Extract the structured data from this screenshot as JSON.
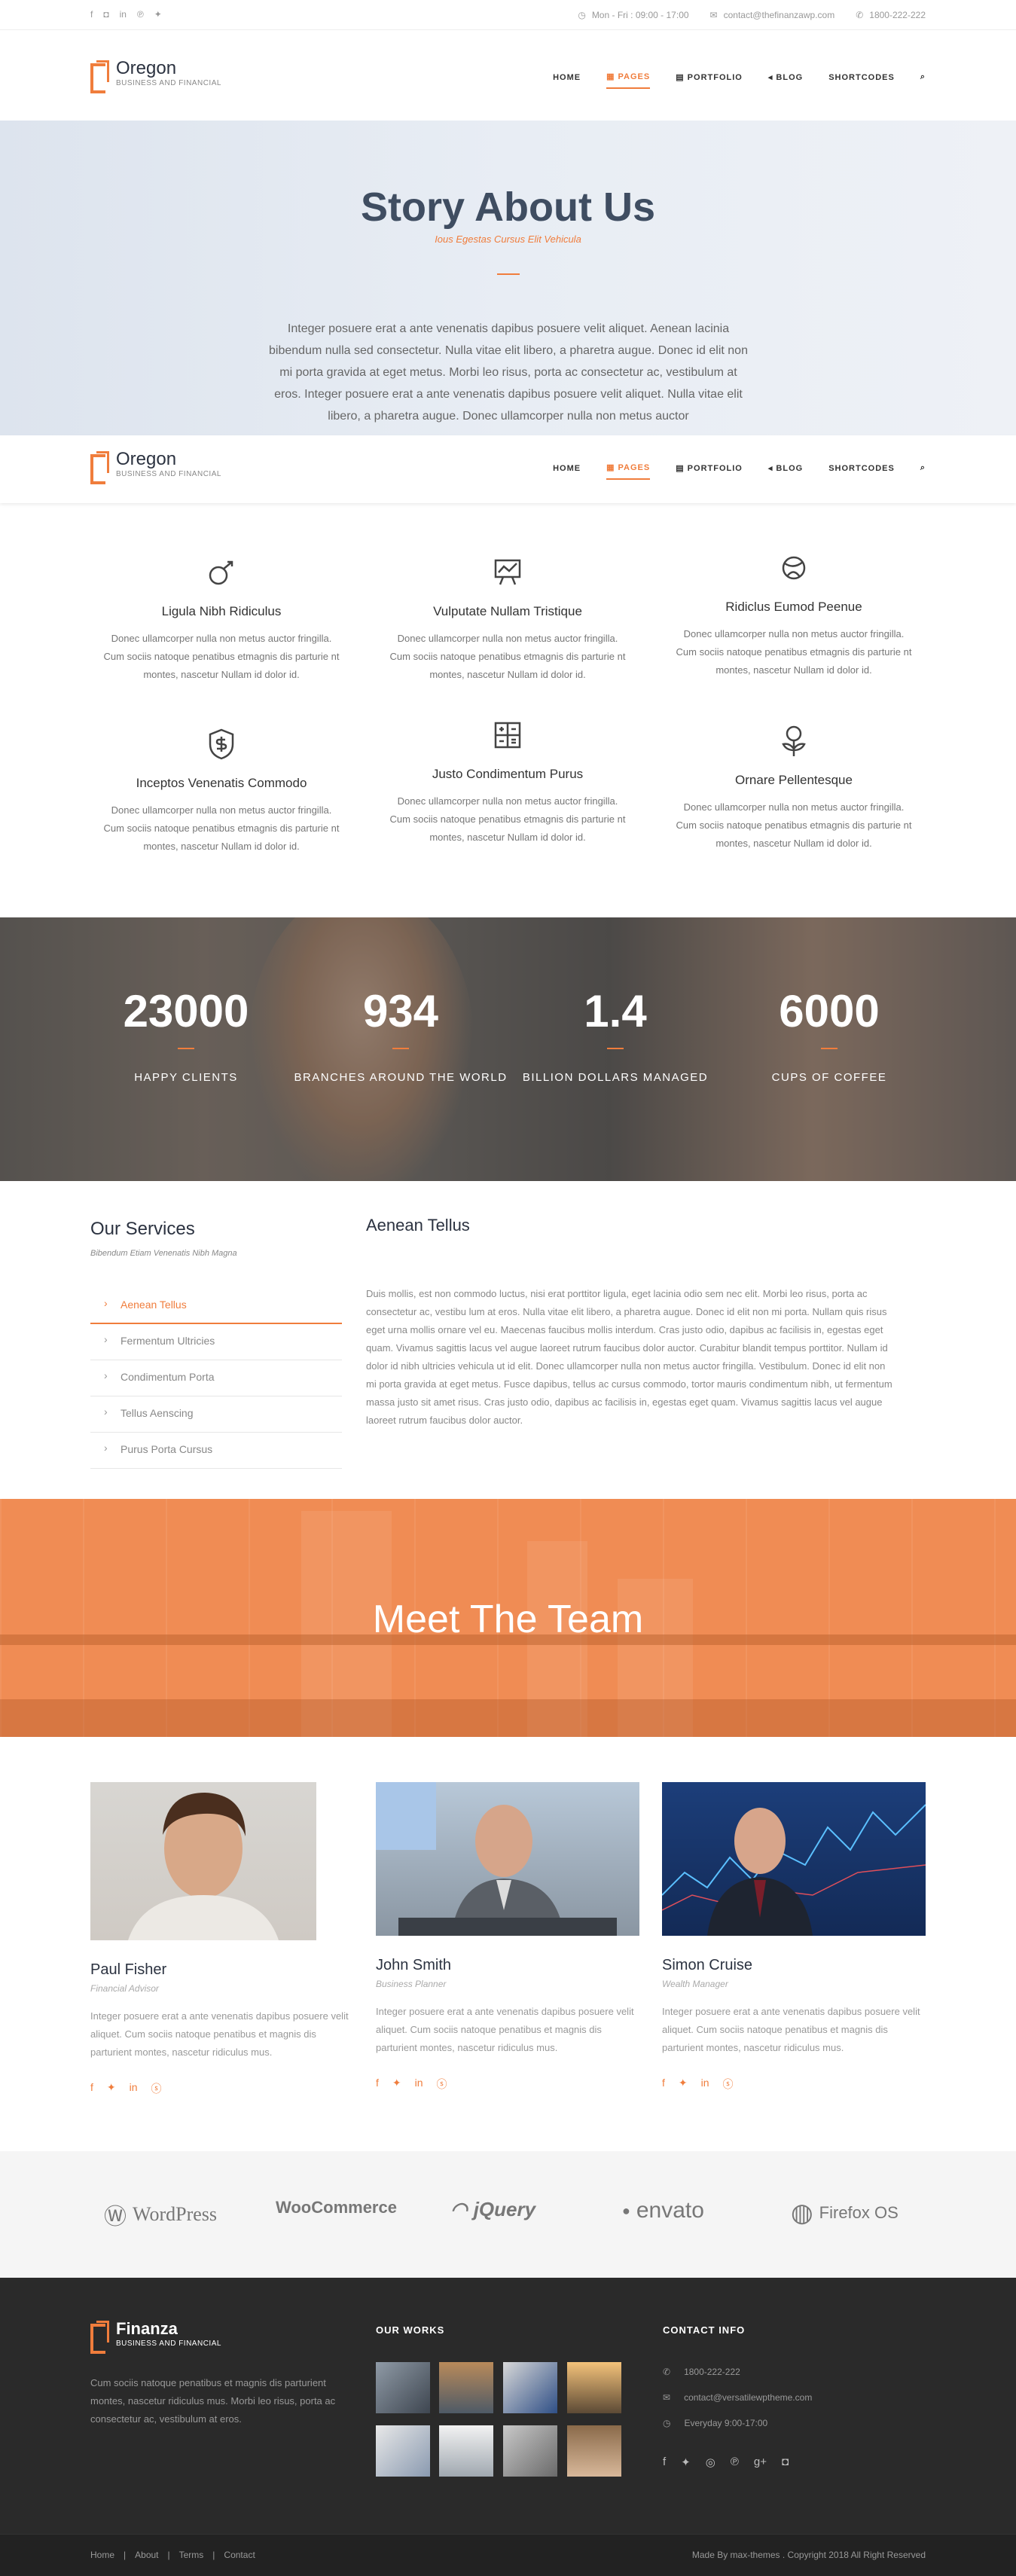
{
  "topbar": {
    "social_icons": [
      "facebook-icon",
      "instagram-icon",
      "linkedin-icon",
      "pinterest-icon",
      "twitter-icon"
    ],
    "hours": "Mon - Fri : 09:00 - 17:00",
    "email": "contact@thefinanzawp.com",
    "phone": "1800-222-222"
  },
  "header": {
    "logo_name": "Oregon",
    "logo_tag": "Business and Financial",
    "nav": [
      "Home",
      "Pages",
      "Portfolio",
      "Blog",
      "Shortcodes"
    ]
  },
  "hero": {
    "title": "Story About Us",
    "subtitle": "Ious Egestas Cursus Elit Vehicula",
    "text": "Integer posuere erat a ante venenatis dapibus posuere velit aliquet. Aenean lacinia bibendum nulla sed consectetur. Nulla vitae elit libero, a pharetra augue. Donec id elit non mi porta gravida at eget metus. Morbi leo risus, porta ac consectetur ac, vestibulum at eros. Integer posuere erat a ante venenatis dapibus posuere velit aliquet. Nulla vitae elit libero, a pharetra augue. Donec ullamcorper nulla non metus auctor"
  },
  "features": [
    {
      "icon": "money-arrow-icon",
      "title": "Ligula Nibh Ridiculus",
      "text": "Donec ullamcorper nulla non metus auctor fringilla. Cum sociis natoque penatibus etmagnis dis parturie nt montes, nascetur Nullam id dolor id."
    },
    {
      "icon": "presentation-chart-icon",
      "title": "Vulputate Nullam Tristique",
      "text": "Donec ullamcorper nulla non metus auctor fringilla. Cum sociis natoque penatibus etmagnis dis parturie nt montes, nascetur Nullam id dolor id."
    },
    {
      "icon": "globe-icon",
      "title": "Ridiclus Eumod Peenue",
      "text": "Donec ullamcorper nulla non metus auctor fringilla. Cum sociis natoque penatibus etmagnis dis parturie nt montes, nascetur Nullam id dolor id."
    },
    {
      "icon": "shield-money-icon",
      "title": "Inceptos Venenatis Commodo",
      "text": "Donec ullamcorper nulla non metus auctor fringilla. Cum sociis natoque penatibus etmagnis dis parturie nt montes, nascetur Nullam id dolor id."
    },
    {
      "icon": "calculator-icon",
      "title": "Justo Condimentum Purus",
      "text": "Donec ullamcorper nulla non metus auctor fringilla. Cum sociis natoque penatibus etmagnis dis parturie nt montes, nascetur Nullam id dolor id."
    },
    {
      "icon": "plant-money-icon",
      "title": "Ornare Pellentesque",
      "text": "Donec ullamcorper nulla non metus auctor fringilla. Cum sociis natoque penatibus etmagnis dis parturie nt montes, nascetur Nullam id dolor id."
    }
  ],
  "counters": [
    {
      "num": "23000",
      "label": "Happy Clients"
    },
    {
      "num": "934",
      "label": "Branches Around The World"
    },
    {
      "num": "1.4",
      "label": "Billion Dollars Managed"
    },
    {
      "num": "6000",
      "label": "Cups Of Coffee"
    }
  ],
  "services": {
    "title": "Our Services",
    "subtitle": "Bibendum Etiam Venenatis Nibh Magna",
    "items": [
      "Aenean Tellus",
      "Fermentum Ultricies",
      "Condimentum Porta",
      "Tellus Aenscing",
      "Purus Porta Cursus"
    ],
    "detail_title": "Aenean Tellus",
    "detail_text": "Duis mollis, est non commodo luctus, nisi erat porttitor ligula, eget lacinia odio sem nec elit. Morbi leo risus, porta ac consectetur ac, vestibu lum at eros. Nulla vitae elit libero, a pharetra augue. Donec id elit non mi porta. Nullam quis risus eget urna mollis ornare vel eu. Maecenas faucibus mollis interdum. Cras justo odio, dapibus ac facilisis in, egestas eget quam. Vivamus sagittis lacus vel augue laoreet rutrum faucibus dolor auctor. Curabitur blandit tempus porttitor. Nullam id dolor id nibh ultricies vehicula ut id elit. Donec ullamcorper nulla non metus auctor fringilla. Vestibulum. Donec id elit non mi porta gravida at eget metus. Fusce dapibus, tellus ac cursus commodo, tortor mauris condimentum nibh, ut fermentum massa justo sit amet risus. Cras justo odio, dapibus ac facilisis in, egestas eget quam. Vivamus sagittis lacus vel augue laoreet rutrum faucibus dolor auctor."
  },
  "team": {
    "banner_title": "Meet The Team",
    "members": [
      {
        "name": "Paul Fisher",
        "role": "Financial Advisor",
        "text": "Integer posuere erat a ante venenatis dapibus posuere velit aliquet. Cum sociis natoque penatibus et magnis dis parturient montes, nascetur ridiculus mus."
      },
      {
        "name": "John Smith",
        "role": "Business Planner",
        "text": "Integer posuere erat a ante venenatis dapibus posuere velit aliquet. Cum sociis natoque penatibus et magnis dis parturient montes, nascetur ridiculus mus."
      },
      {
        "name": "Simon Cruise",
        "role": "Wealth Manager",
        "text": "Integer posuere erat a ante venenatis dapibus posuere velit aliquet. Cum sociis natoque penatibus et magnis dis parturient montes, nascetur ridiculus mus."
      }
    ]
  },
  "partners": [
    "WordPress",
    "WooCommerce",
    "jQuery",
    "envato",
    "Firefox OS"
  ],
  "footer": {
    "logo_name": "Finanza",
    "logo_tag": "Business and Financial",
    "about": "Cum sociis natoque penatibus et magnis dis parturient montes, nascetur ridiculus mus. Morbi leo risus, porta ac consectetur ac, vestibulum at eros.",
    "works_title": "Our Works",
    "contact_title": "Contact Info",
    "phone": "1800-222-222",
    "email": "contact@versatilewptheme.com",
    "hours": "Everyday 9:00-17:00",
    "social_icons": [
      "facebook-icon",
      "twitter-icon",
      "dribbble-icon",
      "pinterest-icon",
      "google-plus-icon",
      "instagram-icon"
    ],
    "links": [
      "Home",
      "About",
      "Terms",
      "Contact"
    ],
    "copyright": "Made By max-themes . Copyright 2018 All Right Reserved"
  },
  "colors": {
    "accent": "#f07d3c",
    "dark": "#2b3240",
    "footer": "#2a2a2a"
  }
}
